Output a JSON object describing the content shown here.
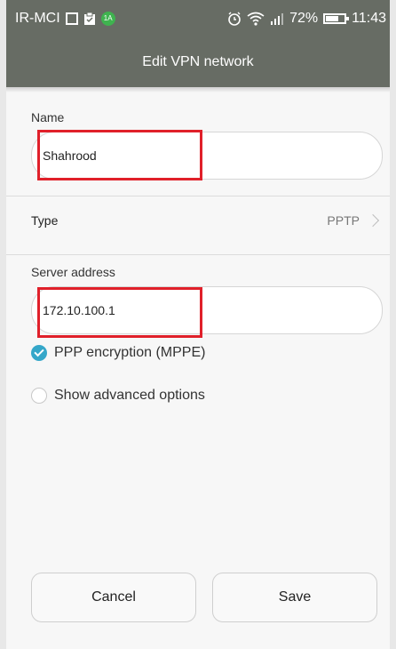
{
  "status_bar": {
    "carrier": "IR-MCI",
    "notif_badge": "1A",
    "battery_percent": "72%",
    "battery_level": 0.72,
    "time": "11:43",
    "icons": [
      "image-notif-icon",
      "clipboard-icon",
      "alarm-icon",
      "wifi-icon",
      "signal-icon",
      "battery-icon"
    ]
  },
  "title": "Edit VPN network",
  "form": {
    "name_label": "Name",
    "name_value": "Shahrood",
    "type_label": "Type",
    "type_value": "PPTP",
    "server_label": "Server address",
    "server_value": "172.10.100.1",
    "ppp_encryption_label": "PPP encryption (MPPE)",
    "ppp_encryption_checked": true,
    "advanced_label": "Show advanced options",
    "advanced_checked": false
  },
  "buttons": {
    "cancel": "Cancel",
    "save": "Save"
  },
  "colors": {
    "header_bg": "#676c64",
    "accent": "#35a7c9",
    "highlight": "#e0202a"
  }
}
